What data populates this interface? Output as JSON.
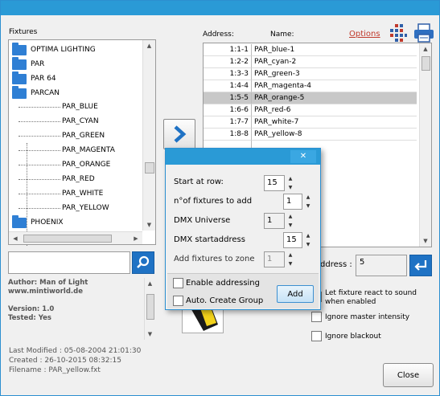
{
  "labels": {
    "fixtures": "Fixtures",
    "address": "Address:",
    "name": "Name:",
    "options": "Options",
    "address_field": "ddress :",
    "address_value": "5",
    "close": "Close"
  },
  "tree": {
    "folders_top": [
      "OPTIMA LIGHTING",
      "PAR",
      "PAR 64",
      "PARCAN"
    ],
    "children": [
      "PAR_BLUE",
      "PAR_CYAN",
      "PAR_GREEN",
      "PAR_MAGENTA",
      "PAR_ORANGE",
      "PAR_RED",
      "PAR_WHITE",
      "PAR_YELLOW"
    ],
    "folders_bottom": [
      "PHOENIX"
    ]
  },
  "search": {
    "value": ""
  },
  "info": {
    "author": "Author: Man of Light",
    "website": "www.mintiworld.de",
    "version": "Version: 1.0",
    "tested": "Tested: Yes"
  },
  "meta": {
    "modified": "Last Modified : 05-08-2004 21:01:30",
    "created": "Created : 26-10-2015 08:32:15",
    "filename": "Filename : PAR_yellow.fxt"
  },
  "table": {
    "rows": [
      {
        "addr": "1:1-1",
        "name": "PAR_blue-1"
      },
      {
        "addr": "1:2-2",
        "name": "PAR_cyan-2"
      },
      {
        "addr": "1:3-3",
        "name": "PAR_green-3"
      },
      {
        "addr": "1:4-4",
        "name": "PAR_magenta-4"
      },
      {
        "addr": "1:5-5",
        "name": "PAR_orange-5"
      },
      {
        "addr": "1:6-6",
        "name": "PAR_red-6"
      },
      {
        "addr": "1:7-7",
        "name": "PAR_white-7"
      },
      {
        "addr": "1:8-8",
        "name": "PAR_yellow-8"
      }
    ],
    "selected_index": 4
  },
  "options": {
    "react_sound": "Let fixture react to sound when enabled",
    "ignore_master": "Ignore master intensity",
    "ignore_blackout": "Ignore blackout"
  },
  "dialog": {
    "close_glyph": "✕",
    "start_row_label": "Start at row:",
    "start_row_value": "15",
    "num_fixtures_label": "n°of fixtures to add",
    "num_fixtures_value": "1",
    "universe_label": "DMX Universe",
    "universe_value": "1",
    "startaddr_label": "DMX startaddress",
    "startaddr_value": "15",
    "zone_label": "Add fixtures to zone",
    "zone_value": "1",
    "enable_addressing": "Enable addressing",
    "auto_group": "Auto. Create Group",
    "add_button": "Add"
  },
  "colors": {
    "titlebar": "#2a9ad6",
    "folder": "#2f7fd4",
    "options_link": "#c0392b",
    "selection": "#c8c8c8"
  }
}
